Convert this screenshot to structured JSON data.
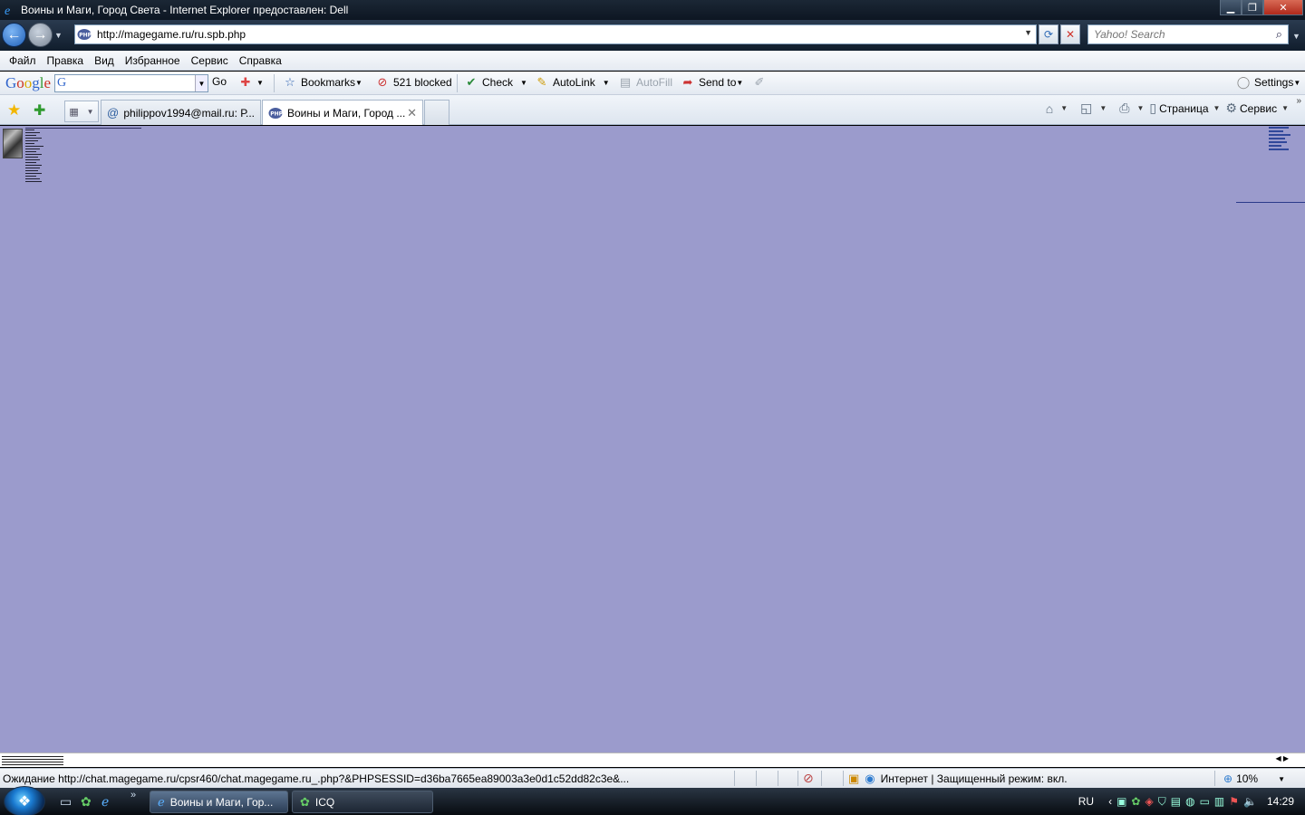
{
  "window": {
    "title": "Воины и Маги, Город Света - Internet Explorer предоставлен: Dell",
    "min_glyph": "▁",
    "max_glyph": "❐",
    "close_glyph": "✕"
  },
  "address_bar": {
    "url": "http://magegame.ru/ru.spb.php",
    "site_icon": "php-icon"
  },
  "search": {
    "placeholder": "Yahoo! Search"
  },
  "menu": [
    "Файл",
    "Правка",
    "Вид",
    "Избранное",
    "Сервис",
    "Справка"
  ],
  "google_toolbar": {
    "logo": {
      "g1": "G",
      "o1": "o",
      "o2": "o",
      "g2": "g",
      "l": "l",
      "e": "e"
    },
    "go_label": "Go",
    "bookmarks_label": "Bookmarks",
    "blocked_label": "521 blocked",
    "check_label": "Check",
    "autolink_label": "AutoLink",
    "autofill_label": "AutoFill",
    "sendto_label": "Send to",
    "settings_label": "Settings"
  },
  "tabs": [
    {
      "label": "philippov1994@mail.ru: Р...",
      "icon": "at-icon",
      "active": false
    },
    {
      "label": "Воины и Маги, Город ...",
      "icon": "php-icon",
      "active": true
    }
  ],
  "command_bar": {
    "page_label": "Страница",
    "tools_label": "Сервис"
  },
  "page": {
    "background": "#9b9bcc"
  },
  "status_bar": {
    "text": "Ожидание http://chat.magegame.ru/cpsr460/chat.magegame.ru_.php?&PHPSESSID=d36ba7665ea89003a3e0d1c52dd82c3e&...",
    "zone": "Интернет | Защищенный режим: вкл.",
    "zoom": "10%"
  },
  "taskbar": {
    "tasks": [
      {
        "label": "Воины и Маги, Гор...",
        "icon": "ie-icon",
        "active": true
      },
      {
        "label": "ICQ",
        "icon": "icq-flower-icon",
        "active": false
      }
    ],
    "language": "RU",
    "clock": "14:29"
  }
}
